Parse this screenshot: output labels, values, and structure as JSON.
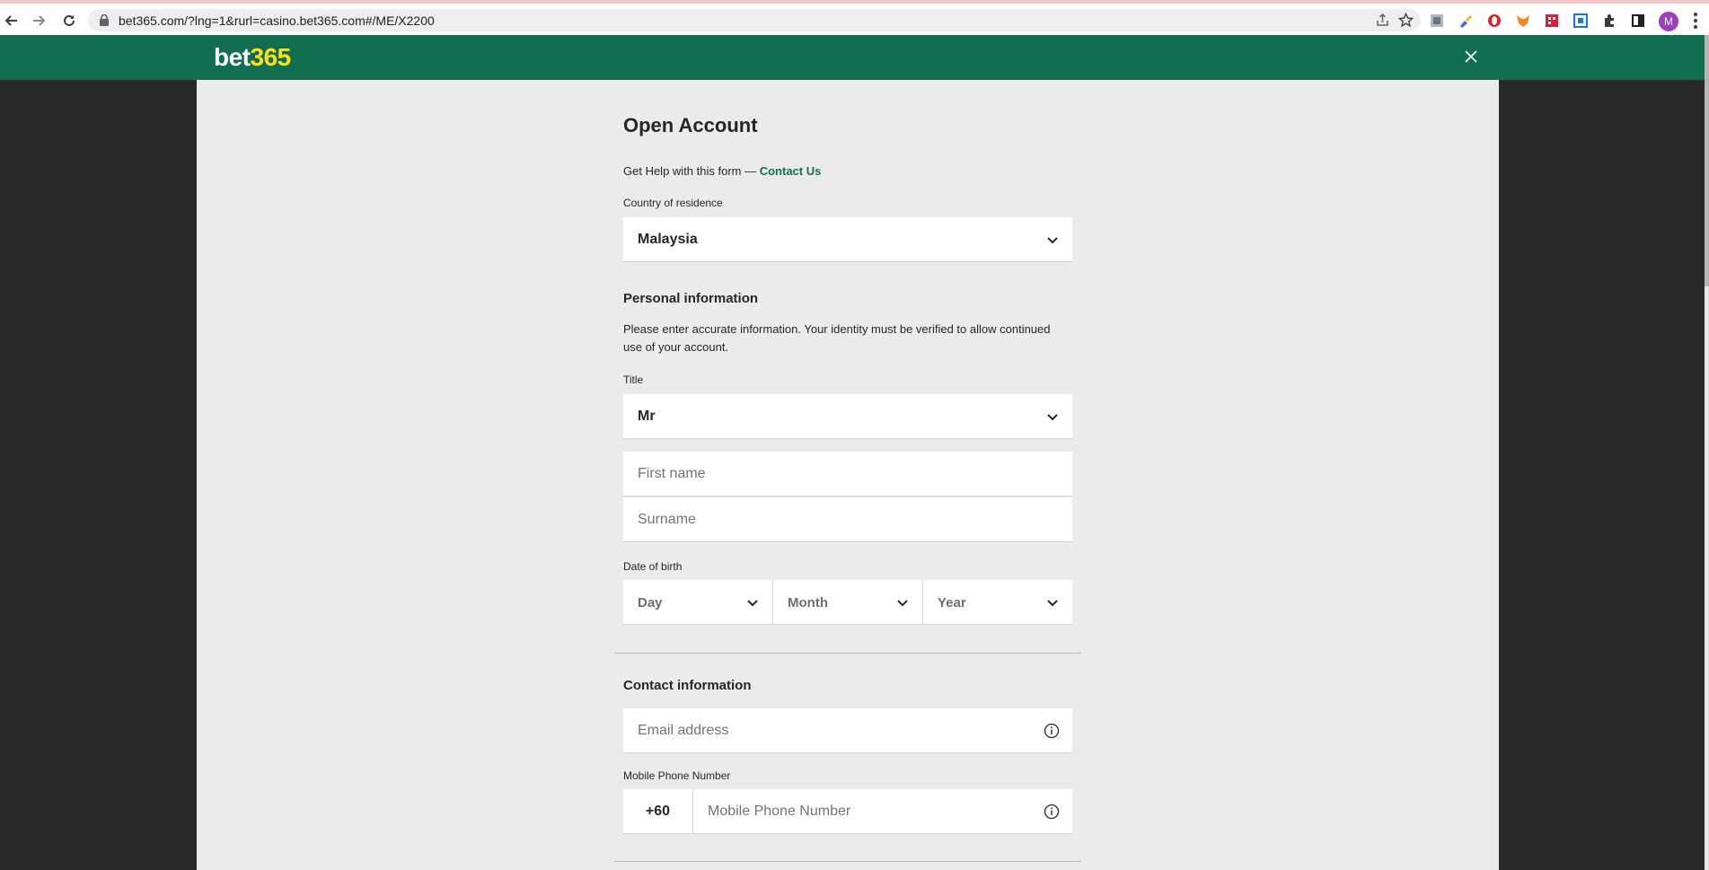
{
  "browser": {
    "url": "bet365.com/?lng=1&rurl=casino.bet365.com#/ME/X2200",
    "profile_initial": "M",
    "icons": [
      "back-arrow-icon",
      "forward-arrow-icon",
      "reload-icon",
      "lock-icon",
      "share-icon",
      "star-icon",
      "extensions-icon",
      "side-panel-icon",
      "menu-icon"
    ],
    "accent_profile": "#9b3fbf"
  },
  "header": {
    "logo_part1": "bet",
    "logo_part2": "365",
    "bg_color": "#126e51",
    "logo_accent": "#ffdf1b"
  },
  "form": {
    "title": "Open Account",
    "help_prefix": "Get Help with this form — ",
    "help_link": "Contact Us",
    "country_label": "Country of residence",
    "country_value": "Malaysia",
    "personal_heading": "Personal information",
    "personal_text": "Please enter accurate information. Your identity must be verified to allow continued use of your account.",
    "title_label": "Title",
    "title_value": "Mr",
    "first_name_placeholder": "First name",
    "surname_placeholder": "Surname",
    "dob_label": "Date of birth",
    "dob_day": "Day",
    "dob_month": "Month",
    "dob_year": "Year",
    "contact_heading": "Contact information",
    "email_placeholder": "Email address",
    "phone_label": "Mobile Phone Number",
    "phone_prefix": "+60",
    "phone_placeholder": "Mobile Phone Number"
  }
}
